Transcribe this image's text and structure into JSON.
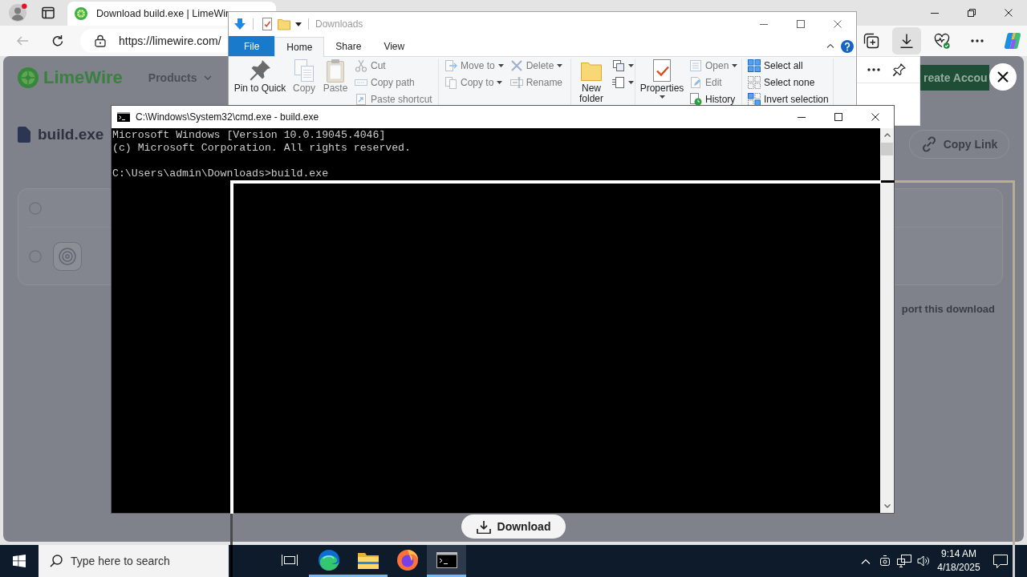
{
  "browser": {
    "tabs": [
      {
        "title": "Download build.exe | LimeWir",
        "selected": true
      }
    ],
    "back": {
      "disabled": true
    },
    "address": "https://limewire.com/",
    "toolbar": [
      {
        "kind": "collections",
        "selected": false
      },
      {
        "kind": "downloads",
        "selected": true
      },
      {
        "kind": "essentials",
        "selected": false
      },
      {
        "kind": "more",
        "selected": false
      },
      {
        "kind": "copilot",
        "selected": false
      }
    ]
  },
  "page": {
    "logo": "LimeWire",
    "nav": [
      {
        "label": "Products"
      }
    ],
    "account_button": "reate Accou",
    "file_name": "build.exe",
    "copy_link": "Copy Link",
    "select_all": {
      "checked": false
    },
    "files": [
      {
        "checked": false
      }
    ],
    "report_link": "port this download",
    "download_button": "Download"
  },
  "explorer": {
    "title": "Downloads",
    "tabs": [
      {
        "label": "File",
        "kind": "menu",
        "selected": false
      },
      {
        "label": "Home",
        "kind": "tab",
        "selected": true
      },
      {
        "label": "Share",
        "kind": "tab",
        "selected": false
      },
      {
        "label": "View",
        "kind": "tab",
        "selected": false
      }
    ],
    "ribbon": [
      {
        "large": [
          {
            "label": "Pin to Quick",
            "disabled": false,
            "dropdown": false
          },
          {
            "label": "Copy",
            "disabled": true,
            "dropdown": false
          },
          {
            "label": "Paste",
            "disabled": true,
            "dropdown": false
          }
        ],
        "small": [
          [
            {
              "label": "Cut",
              "disabled": true,
              "dropdown": false
            },
            {
              "label": "Copy path",
              "disabled": true,
              "dropdown": false
            },
            {
              "label": "Paste shortcut",
              "disabled": true,
              "dropdown": false
            }
          ]
        ]
      },
      {
        "small": [
          [
            {
              "label": "Move to",
              "disabled": true,
              "dropdown": true
            },
            {
              "label": "Copy to",
              "disabled": true,
              "dropdown": true
            }
          ],
          [
            {
              "label": "Delete",
              "disabled": true,
              "dropdown": true
            },
            {
              "label": "Rename",
              "disabled": true,
              "dropdown": false
            }
          ]
        ]
      },
      {
        "large": [
          {
            "label": "New folder",
            "disabled": false,
            "dropdown": false
          }
        ],
        "small": [
          [
            {
              "disabled": false,
              "dropdown": true
            },
            {
              "disabled": false,
              "dropdown": true
            }
          ]
        ]
      },
      {
        "large": [
          {
            "label": "Properties",
            "disabled": false,
            "dropdown": true
          }
        ],
        "small": [
          [
            {
              "label": "Open",
              "disabled": true,
              "dropdown": true
            },
            {
              "label": "Edit",
              "disabled": true,
              "dropdown": false
            },
            {
              "label": "History",
              "disabled": false,
              "dropdown": false
            }
          ]
        ]
      },
      {
        "small": [
          [
            {
              "label": "Select all",
              "disabled": false,
              "dropdown": false
            },
            {
              "label": "Select none",
              "disabled": false,
              "dropdown": false
            },
            {
              "label": "Invert selection",
              "disabled": false,
              "dropdown": false
            }
          ]
        ]
      }
    ]
  },
  "console": {
    "title": "C:\\Windows\\System32\\cmd.exe - build.exe",
    "paragraphs": [
      [
        "Microsoft Windows [Version 10.0.19045.4046]",
        "(c) Microsoft Corporation. All rights reserved."
      ],
      [
        "C:\\Users\\admin\\Downloads>build.exe"
      ]
    ]
  },
  "taskbar": {
    "search": {
      "placeholder": "Type here to search"
    },
    "apps": [
      {
        "kind": "task-view",
        "running": false,
        "selected": false
      },
      {
        "kind": "edge",
        "running": true,
        "selected": false
      },
      {
        "kind": "explorer",
        "running": true,
        "selected": false
      },
      {
        "kind": "firefox",
        "running": false,
        "selected": false
      },
      {
        "kind": "console",
        "running": true,
        "selected": true
      }
    ],
    "clock": {
      "time": "9:14 AM",
      "date": "4/18/2025"
    }
  }
}
